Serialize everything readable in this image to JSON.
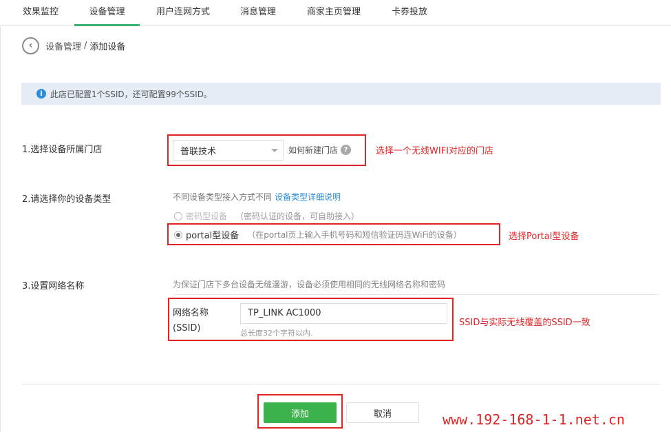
{
  "nav": {
    "tabs": [
      {
        "label": "效果监控"
      },
      {
        "label": "设备管理"
      },
      {
        "label": "用户连网方式"
      },
      {
        "label": "消息管理"
      },
      {
        "label": "商家主页管理"
      },
      {
        "label": "卡券投放"
      }
    ],
    "active_index": 1
  },
  "breadcrumb": {
    "back_icon": "chevron-left-icon",
    "parent": "设备管理",
    "separator": "/",
    "current": "添加设备"
  },
  "notice": {
    "icon": "info-icon",
    "text": "此店已配置1个SSID，还可配置99个SSID。"
  },
  "step1": {
    "label": "1.选择设备所属门店",
    "store_select_value": "普联技术",
    "how_link": "如何新建门店",
    "help_icon": "?",
    "annotation": "选择一个无线WIFI对应的门店"
  },
  "step2": {
    "label": "2.请选择你的设备类型",
    "hint": "不同设备类型接入方式不同",
    "hint_link": "设备类型详细说明",
    "options": [
      {
        "label": "密码型设备",
        "desc": "（密码认证的设备，可自助接入）",
        "checked": false,
        "disabled": true
      },
      {
        "label": "portal型设备",
        "desc": "（在portal页上输入手机号码和短信验证码连WiFi的设备）",
        "checked": true,
        "disabled": false
      }
    ],
    "annotation": "选择Portal型设备"
  },
  "step3": {
    "label": "3.设置网络名称",
    "hint": "为保证门店下多台设备无缝漫游，设备必须使用相同的无线网络名称和密码",
    "ssid_label_line1": "网络名称",
    "ssid_label_line2": "(SSID)",
    "ssid_value": "TP_LINK AC1000",
    "ssid_help": "总长度32个字符以内.",
    "annotation": "SSID与实际无线覆盖的SSID一致"
  },
  "buttons": {
    "add": "添加",
    "cancel": "取消"
  },
  "watermark": "www.192-168-1-1.net.cn",
  "colors": {
    "accent_green": "#3cb34a",
    "annotation_red": "#e02424",
    "link_blue": "#2b8ddb",
    "notice_bg": "#e5eef7"
  }
}
